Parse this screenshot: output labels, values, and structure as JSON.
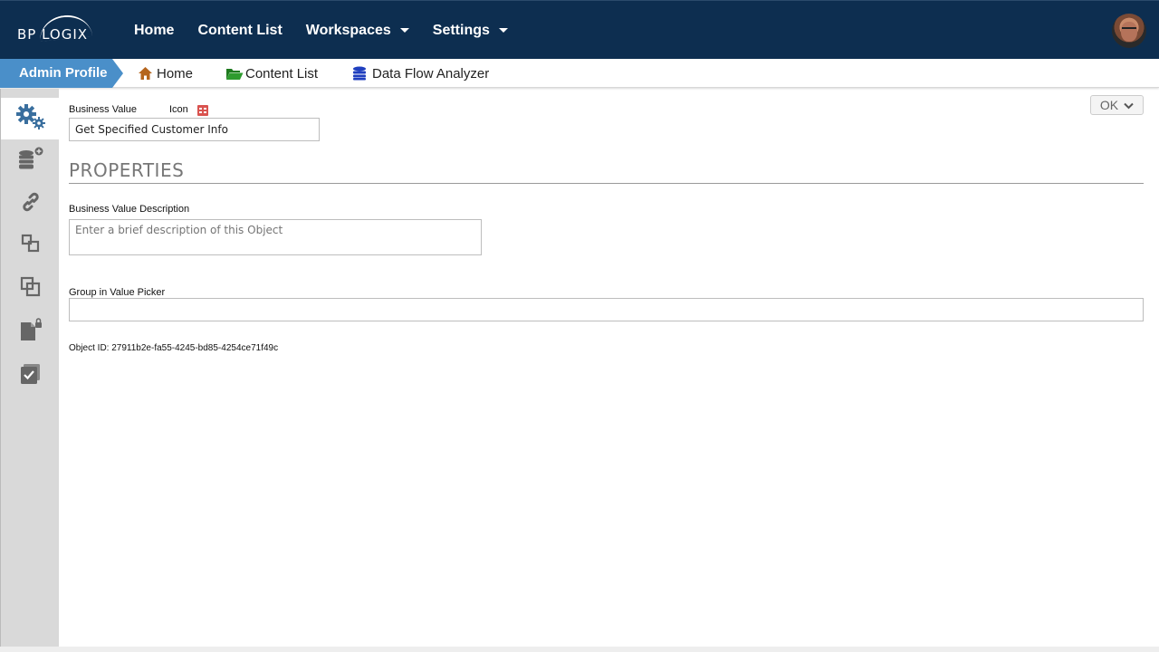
{
  "brand": {
    "logo_text": "BP LOGIX"
  },
  "topnav": {
    "items": [
      {
        "label": "Home",
        "dropdown": false
      },
      {
        "label": "Content List",
        "dropdown": false
      },
      {
        "label": "Workspaces",
        "dropdown": true
      },
      {
        "label": "Settings",
        "dropdown": true
      }
    ]
  },
  "breadcrumb": {
    "active": "Admin Profile",
    "items": [
      {
        "label": "Home",
        "icon": "home-icon"
      },
      {
        "label": "Content List",
        "icon": "folder-open-icon"
      },
      {
        "label": "Data Flow Analyzer",
        "icon": "database-icon"
      }
    ]
  },
  "sidebar": {
    "items": [
      {
        "icon": "gears-icon",
        "active": true
      },
      {
        "icon": "database-add-icon",
        "active": false
      },
      {
        "icon": "link-icon",
        "active": false
      },
      {
        "icon": "relationship-icon",
        "active": false
      },
      {
        "icon": "copy-icon",
        "active": false
      },
      {
        "icon": "locked-document-icon",
        "active": false
      },
      {
        "icon": "checked-box-icon",
        "active": false
      }
    ]
  },
  "form": {
    "business_value_label": "Business Value",
    "icon_label": "Icon",
    "business_value": "Get Specified Customer Info",
    "section_title": "PROPERTIES",
    "description_label": "Business Value Description",
    "description_placeholder": "Enter a brief description of this Object",
    "description_value": "",
    "group_label": "Group in Value Picker",
    "group_value": "",
    "object_id_text": "Object ID: 27911b2e-fa55-4245-bd85-4254ce71f49c",
    "ok_label": "OK"
  },
  "colors": {
    "topbar": "#0d2e50",
    "breadcrumb_active": "#4a8fc9",
    "sidebar": "#d9d9d9",
    "icon_accent": "#3a6f9e",
    "home_icon": "#b5651d",
    "folder_icon": "#2e8b2e",
    "database_icon": "#1f3fbf",
    "icon_picker": "#d9534f"
  }
}
